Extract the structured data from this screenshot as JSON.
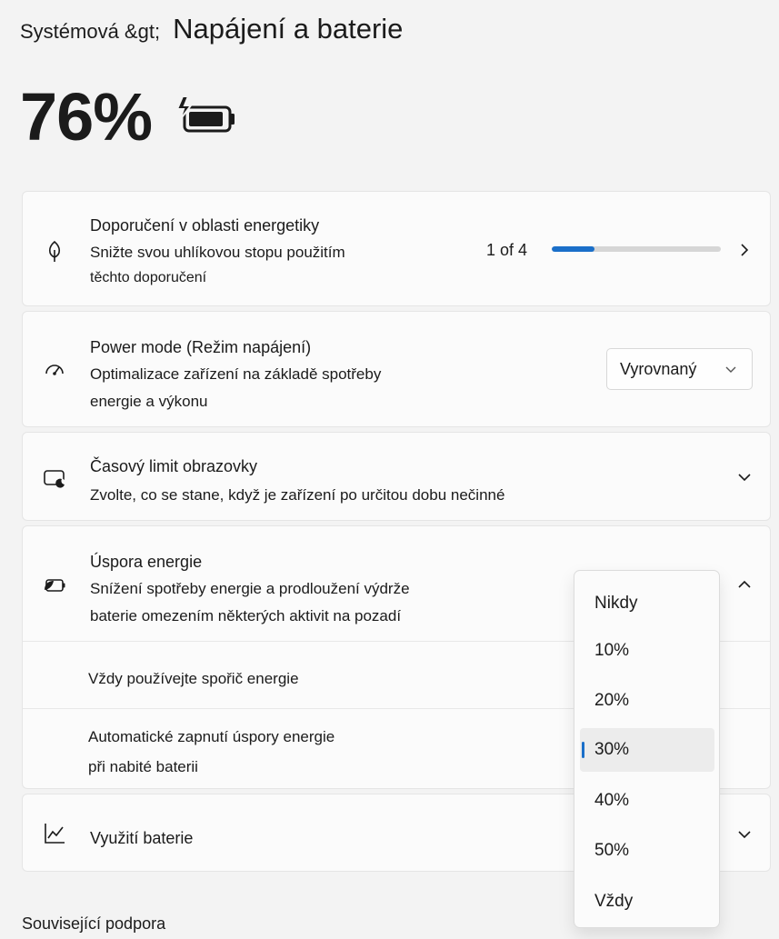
{
  "header": {
    "breadcrumb_parent": "Systémová &gt;",
    "page_title": "Napájení a baterie"
  },
  "battery": {
    "percent_text": "76%",
    "icon": "battery-charging-icon",
    "level": 0.76
  },
  "energy_recommendations": {
    "icon": "leaf-icon",
    "title": "Doporučení v oblasti energetiky",
    "description_line1": "Snižte svou uhlíkovou stopu použitím",
    "description_line2": "těchto doporučení",
    "progress_text": "1 of 4",
    "progress_fraction": 0.25
  },
  "power_mode": {
    "icon": "speedometer-icon",
    "title": "Power mode (Režim napájení)",
    "description_line1": "Optimalizace zařízení na základě spotřeby",
    "description_line2": "energie a výkonu",
    "selected_value": "Vyrovnaný"
  },
  "screen_timeout": {
    "icon": "screen-timeout-icon",
    "title": "Časový limit obrazovky",
    "description": "Zvolte, co se stane, když je zařízení po určitou dobu nečinné"
  },
  "battery_saver": {
    "icon": "battery-saver-icon",
    "title": "Úspora energie",
    "description_line1": "Snížení spotřeby energie a prodloužení výdrže",
    "description_line2": "baterie omezením některých aktivit na pozadí",
    "always_use_label": "Vždy používejte spořič energie",
    "auto_on_line1": "Automatické zapnutí úspory energie",
    "auto_on_line2": "při nabité baterii"
  },
  "dropdown": {
    "options": [
      "Nikdy",
      "10%",
      "20%",
      "30%",
      "40%",
      "50%",
      "Vždy"
    ],
    "selected": "30%"
  },
  "battery_usage": {
    "icon": "chart-icon",
    "title": "Využití baterie"
  },
  "related_support": {
    "label": "Související podpora"
  },
  "colors": {
    "accent": "#1a6fc9",
    "background": "#f3f3f3",
    "card": "#fbfbfb"
  }
}
